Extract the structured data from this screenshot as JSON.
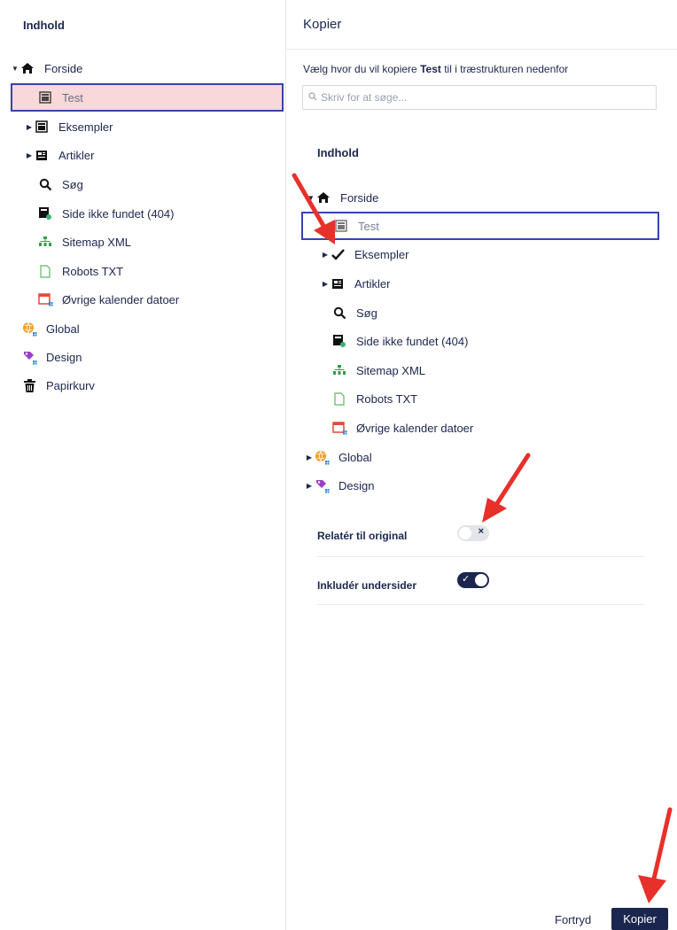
{
  "left": {
    "title": "Indhold",
    "items": [
      {
        "label": "Forside",
        "icon": "home-icon"
      },
      {
        "label": "Test",
        "icon": "page-icon"
      },
      {
        "label": "Eksempler",
        "icon": "page-icon"
      },
      {
        "label": "Artikler",
        "icon": "news-icon"
      },
      {
        "label": "Søg",
        "icon": "search-icon"
      },
      {
        "label": "Side ikke fundet (404)",
        "icon": "notfound-icon"
      },
      {
        "label": "Sitemap XML",
        "icon": "sitemap-icon"
      },
      {
        "label": "Robots TXT",
        "icon": "file-icon"
      },
      {
        "label": "Øvrige kalender datoer",
        "icon": "calendar-icon"
      },
      {
        "label": "Global",
        "icon": "globe-icon"
      },
      {
        "label": "Design",
        "icon": "design-icon"
      },
      {
        "label": "Papirkurv",
        "icon": "trash-icon"
      }
    ]
  },
  "dialog": {
    "title": "Kopier",
    "instruction_before": "Vælg hvor du vil kopiere ",
    "instruction_bold": "Test",
    "instruction_after": " til i træstrukturen nedenfor",
    "search_placeholder": "Skriv for at søge...",
    "tree_title": "Indhold",
    "tree": [
      {
        "label": "Forside"
      },
      {
        "label": "Test"
      },
      {
        "label": "Eksempler"
      },
      {
        "label": "Artikler"
      },
      {
        "label": "Søg"
      },
      {
        "label": "Side ikke fundet (404)"
      },
      {
        "label": "Sitemap XML"
      },
      {
        "label": "Robots TXT"
      },
      {
        "label": "Øvrige kalender datoer"
      },
      {
        "label": "Global"
      },
      {
        "label": "Design"
      }
    ],
    "options": [
      {
        "label": "Relatér til original",
        "value": false
      },
      {
        "label": "Inkludér undersider",
        "value": true
      }
    ],
    "cancel_label": "Fortryd",
    "submit_label": "Kopier"
  },
  "colors": {
    "primary": "#1b264f",
    "selected_bg": "#f8d8d8",
    "selected_border": "#3544b1",
    "arrow": "#e8302a"
  }
}
